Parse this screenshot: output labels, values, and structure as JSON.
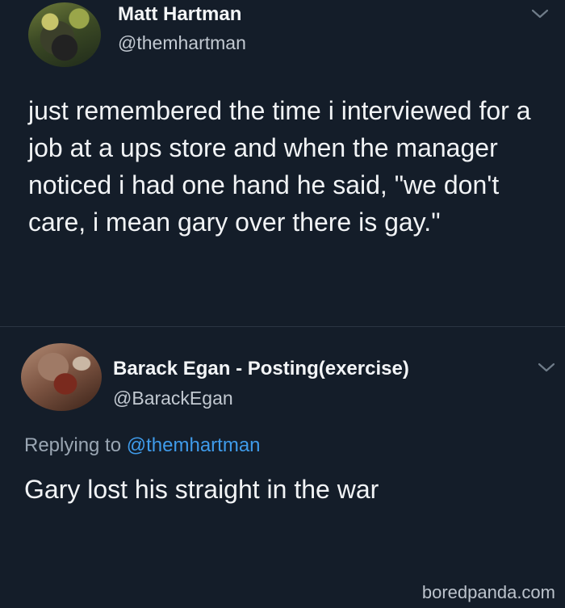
{
  "tweet": {
    "author_name": "Matt Hartman",
    "author_handle": "@themhartman",
    "text": "just remembered the time i interviewed for a job at a ups store and when the manager noticed i had one hand he said, \"we don't care, i mean gary over there is gay.\""
  },
  "reply": {
    "author_name": "Barack Egan - Posting(exercise)",
    "author_handle": "@BarackEgan",
    "replying_to_prefix": "Replying to",
    "replying_to_handle": "@themhartman",
    "text": "Gary lost his straight in the war"
  },
  "watermark": "boredpanda.com",
  "icons": {
    "menu": "chevron-down-icon"
  },
  "colors": {
    "background": "#141d29",
    "mention": "#3f9bea"
  }
}
